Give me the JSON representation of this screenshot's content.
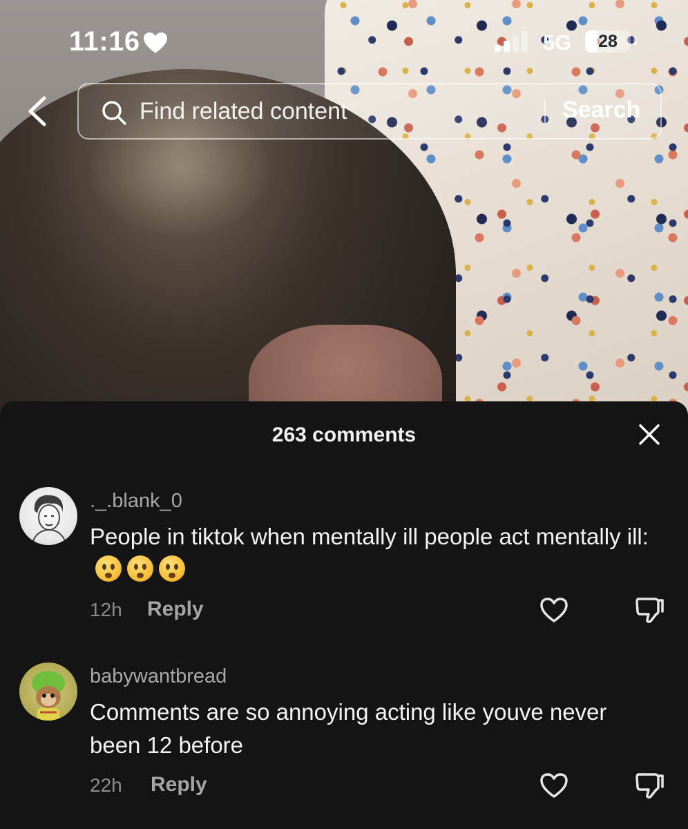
{
  "status_bar": {
    "time": "11:16",
    "network": "5G",
    "battery_level": "28",
    "battery_fraction": 0.28
  },
  "search": {
    "placeholder": "Find related content",
    "button_label": "Search"
  },
  "comments": {
    "count_label": "263 comments",
    "items": [
      {
        "username": "._.blank_0",
        "text": "People in tiktok when mentally ill people act mentally ill:",
        "emoji_count": 3,
        "time": "12h",
        "reply_label": "Reply"
      },
      {
        "username": "babywantbread",
        "text": "Comments are so annoying acting like youve never been 12 before",
        "time": "22h",
        "reply_label": "Reply"
      }
    ]
  },
  "icons": {
    "heart": "heart-icon",
    "signal": "signal-bars-icon",
    "back": "chevron-left-icon",
    "search": "magnifier-icon",
    "close": "close-icon",
    "like": "heart-outline-icon",
    "dislike": "thumbs-down-icon"
  },
  "colors": {
    "sheet_background": "#141414",
    "primary_text": "#f4f4f4",
    "secondary_text": "#a8a8a8"
  }
}
